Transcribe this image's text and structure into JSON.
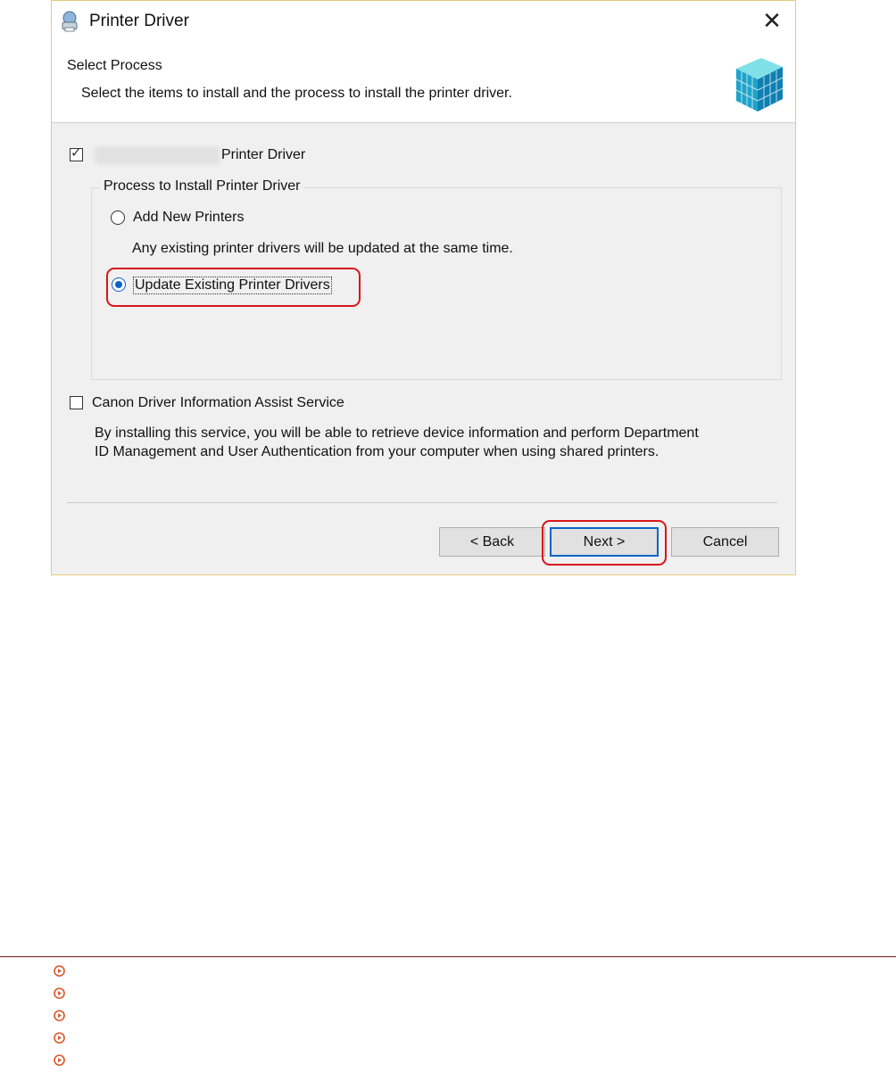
{
  "window": {
    "title": "Printer Driver",
    "close_glyph": "✕"
  },
  "header": {
    "step_title": "Select Process",
    "step_description": "Select the items to install and the process to install the printer driver."
  },
  "printer_driver_option": {
    "checked": true,
    "label_suffix": "Printer Driver"
  },
  "process_group": {
    "legend": "Process to Install Printer Driver",
    "options": [
      {
        "label": "Add New Printers",
        "selected": false
      },
      {
        "label": "Update Existing Printer Drivers",
        "selected": true
      }
    ],
    "note": "Any existing printer drivers will be updated at the same time."
  },
  "assist_service": {
    "checked": false,
    "label": "Canon Driver Information Assist Service",
    "description_line1": "By installing this service, you will be able to retrieve device information and perform Department",
    "description_line2": "ID Management and User Authentication from your computer when using shared printers."
  },
  "buttons": {
    "back": "< Back",
    "next": "Next >",
    "cancel": "Cancel"
  },
  "colors": {
    "highlight": "#d6151c",
    "accent": "#0a64c8",
    "bullet": "#d9572a"
  },
  "icons": [
    "printer-app-icon",
    "close-icon",
    "canon-cube-logo",
    "bullet-icon"
  ]
}
